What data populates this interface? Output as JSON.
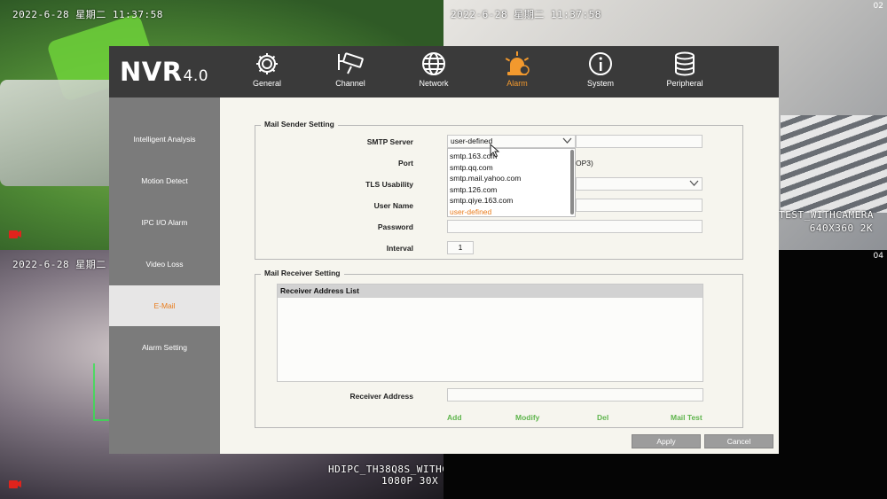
{
  "cameras": {
    "ch1": {
      "timestamp": "2022-6-28 星期二 11:37:58"
    },
    "ch2": {
      "timestamp": "2022-6-28 星期二 11:37:58",
      "num": "02",
      "caption_line1": "D_TEST_WITHCAMERA",
      "caption_line2": "640X360 2K"
    },
    "ch3": {
      "timestamp": "2022-6-28 星期二",
      "caption_line1": "HDIPC_TH38Q8S_WITHC",
      "caption_line2": "1080P 30X"
    },
    "ch4": {
      "num": "04"
    }
  },
  "app": {
    "logo": "NVR",
    "version": "4.0"
  },
  "nav": {
    "items": [
      {
        "label": "General",
        "icon": "gear-icon"
      },
      {
        "label": "Channel",
        "icon": "camera-icon"
      },
      {
        "label": "Network",
        "icon": "globe-icon"
      },
      {
        "label": "Alarm",
        "icon": "alarm-icon",
        "active": true
      },
      {
        "label": "System",
        "icon": "info-icon"
      },
      {
        "label": "Peripheral",
        "icon": "database-icon"
      }
    ]
  },
  "sidebar": {
    "items": [
      {
        "label": "Intelligent Analysis"
      },
      {
        "label": "Motion Detect"
      },
      {
        "label": "IPC I/O Alarm"
      },
      {
        "label": "Video Loss"
      },
      {
        "label": "E-Mail",
        "active": true
      },
      {
        "label": "Alarm Setting"
      }
    ]
  },
  "sender": {
    "title": "Mail Sender Setting",
    "smtp_label": "SMTP Server",
    "smtp_value": "user-defined",
    "smtp_custom": "",
    "smtp_options": [
      "smtp.163.com",
      "smtp.qq.com",
      "smtp.mail.yahoo.com",
      "smtp.126.com",
      "smtp.qiye.163.com",
      "user-defined"
    ],
    "port_label": "Port",
    "port_hint": "OP3)",
    "tls_label": "TLS Usability",
    "user_label": "User Name",
    "password_label": "Password",
    "interval_label": "Interval",
    "interval_value": "1"
  },
  "receiver": {
    "title": "Mail Receiver Setting",
    "list_header": "Receiver Address List",
    "address_label": "Receiver Address",
    "address_value": "",
    "add": "Add",
    "modify": "Modify",
    "del": "Del",
    "test": "Mail Test"
  },
  "buttons": {
    "apply": "Apply",
    "cancel": "Cancel"
  },
  "colors": {
    "accent": "#e97c1c",
    "link": "#5fb54d",
    "topbar": "#3a3a3a",
    "sidebar": "#7b7b7b"
  }
}
